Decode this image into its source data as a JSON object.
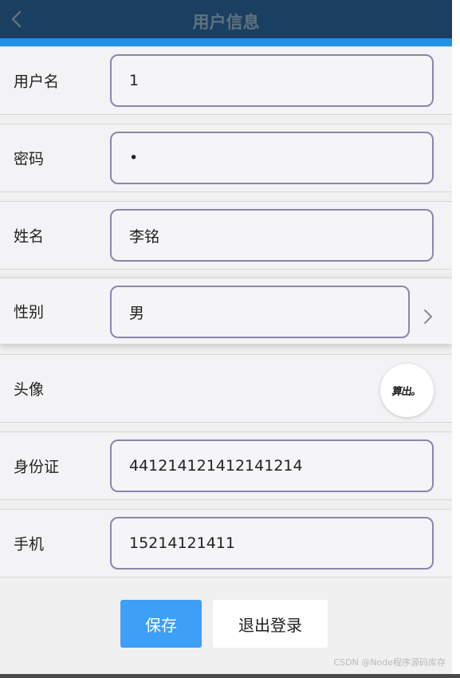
{
  "header": {
    "title": "用户信息",
    "back_icon": "chevron-left-icon"
  },
  "form": {
    "username": {
      "label": "用户名",
      "value": "1"
    },
    "password": {
      "label": "密码",
      "value": "•"
    },
    "name": {
      "label": "姓名",
      "value": "李铭"
    },
    "gender": {
      "label": "性别",
      "value": "男",
      "icon": "chevron-right-icon"
    },
    "avatar": {
      "label": "头像",
      "image_text": "算出。"
    },
    "id_card": {
      "label": "身份证",
      "value": "441214121412141214"
    },
    "phone": {
      "label": "手机",
      "value": "15214121411"
    }
  },
  "actions": {
    "save_label": "保存",
    "logout_label": "退出登录"
  },
  "watermark": "CSDN @Node程序源码库存",
  "colors": {
    "header_bg": "#1b3f60",
    "accent": "#1e90e8",
    "save_button": "#3d9ff5",
    "field_border": "#8a86aa"
  }
}
